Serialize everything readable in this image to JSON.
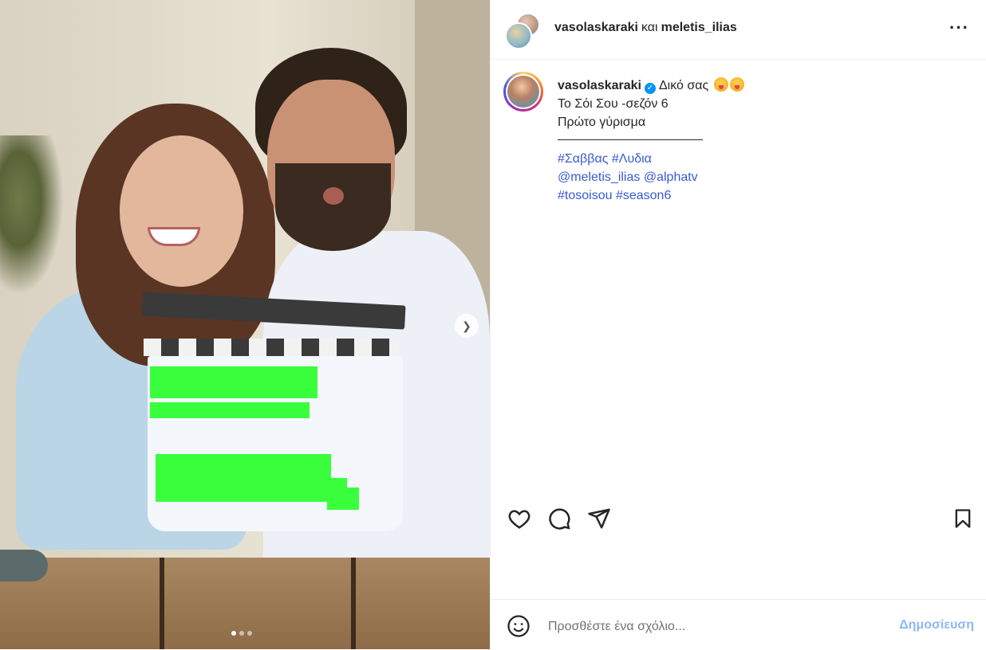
{
  "media": {
    "next_icon": "chevron-right-icon",
    "carousel": {
      "count": 3,
      "active": 0
    }
  },
  "header": {
    "user1": "vasolaskaraki",
    "conjunction": "και",
    "user2": "meletis_ilias",
    "more_icon": "more-horizontal-icon"
  },
  "caption": {
    "username": "vasolaskaraki",
    "verified_icon": "verified-badge-icon",
    "line1": "Δικό σας",
    "line2": "Το Σόι Σου -σεζόν 6",
    "line3": "Πρώτο γύρισμα",
    "tags_line1": [
      "#Σαββας",
      "#Λυδια"
    ],
    "tags_line2": [
      "@meletis_ilias",
      "@alphatv"
    ],
    "tags_line3": [
      "#tosoisou",
      "#season6"
    ]
  },
  "actions": {
    "like_icon": "heart-icon",
    "comment_icon": "comment-icon",
    "share_icon": "paper-plane-icon",
    "save_icon": "bookmark-icon"
  },
  "comment_box": {
    "emoji_icon": "smile-icon",
    "placeholder": "Προσθέστε ένα σχόλιο...",
    "post_label": "Δημοσίευση"
  }
}
